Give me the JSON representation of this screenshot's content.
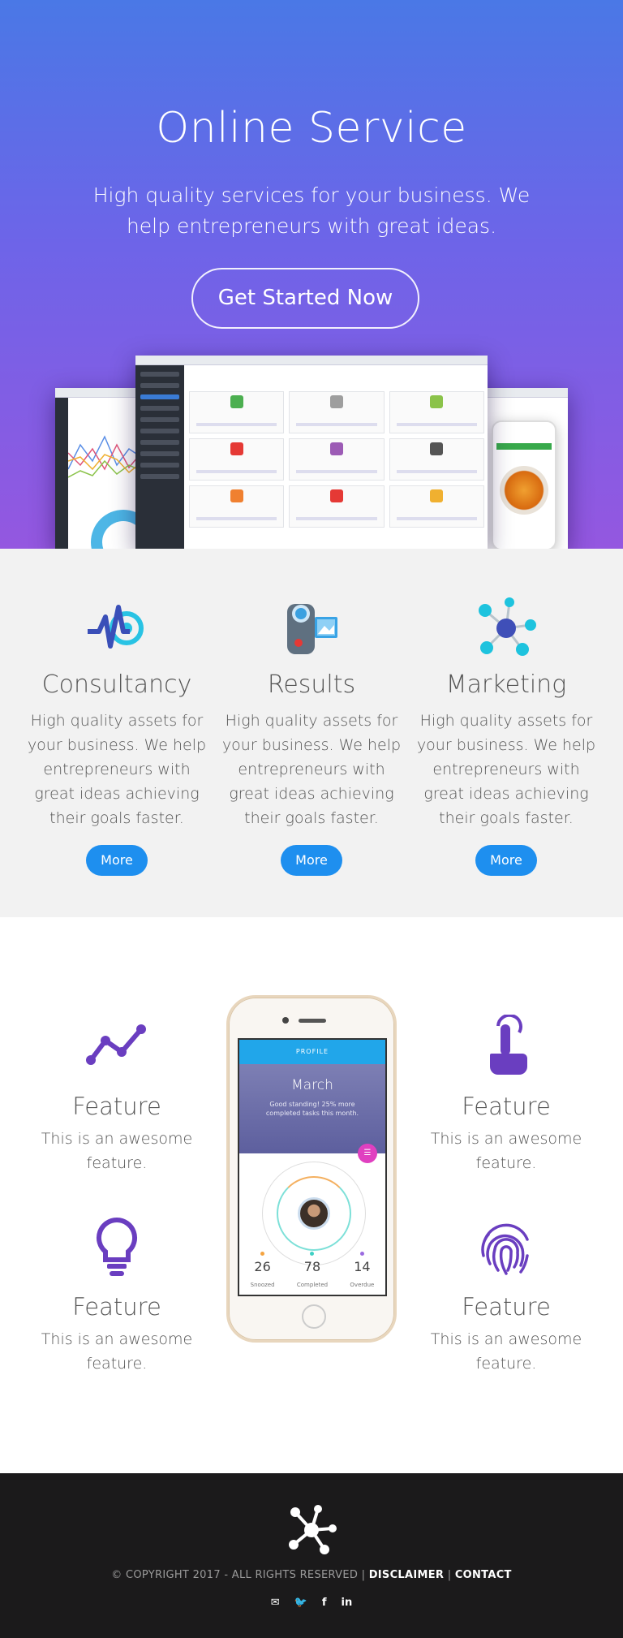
{
  "hero": {
    "title": "Online Service",
    "subtitle": "High quality services for your business. We help entrepreneurs with great ideas.",
    "cta_label": "Get Started Now"
  },
  "services": [
    {
      "icon": "consultancy-icon",
      "title": "Consultancy",
      "text": "High quality assets for your business. We help entrepreneurs with great ideas achieving their goals faster.",
      "button": "More"
    },
    {
      "icon": "video-camera-icon",
      "title": "Results",
      "text": "High quality assets for your business. We help entrepreneurs with great ideas achieving their goals faster.",
      "button": "More"
    },
    {
      "icon": "network-icon",
      "title": "Marketing",
      "text": "High quality assets for your business. We help entrepreneurs with great ideas achieving their goals faster.",
      "button": "More"
    }
  ],
  "features": [
    {
      "icon": "trend-line-icon",
      "title": "Feature",
      "text": "This is an awesome feature."
    },
    {
      "icon": "tap-hand-icon",
      "title": "Feature",
      "text": "This is an awesome feature."
    },
    {
      "icon": "lightbulb-icon",
      "title": "Feature",
      "text": "This is an awesome feature."
    },
    {
      "icon": "fingerprint-icon",
      "title": "Feature",
      "text": "This is an awesome feature."
    }
  ],
  "phone_app": {
    "header": "PROFILE",
    "month": "March",
    "note": "Good standing! 25% more completed tasks this month.",
    "stats": [
      {
        "value": "26",
        "label": "Snoozed",
        "color": "#f4a340"
      },
      {
        "value": "78",
        "label": "Completed",
        "color": "#3fd0c4"
      },
      {
        "value": "14",
        "label": "Overdue",
        "color": "#9b6be0"
      }
    ]
  },
  "footer": {
    "copyright": "© COPYRIGHT 2017 - ALL RIGHTS RESERVED |",
    "separator": "|",
    "disclaimer": "DISCLAIMER",
    "contact": "CONTACT",
    "social": {
      "email": "✉",
      "twitter": "🐦",
      "facebook": "f",
      "linkedin": "in"
    }
  },
  "colors": {
    "hero_top": "#4a78e6",
    "hero_bottom": "#9457e0",
    "accent_blue": "#1e8fef",
    "feature_purple": "#6a3ec0",
    "footer_bg": "#1b1a1b"
  }
}
